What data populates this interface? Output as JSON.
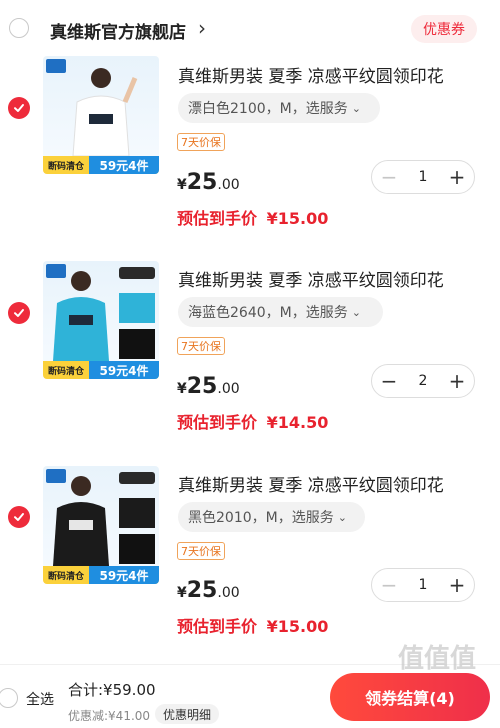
{
  "store": {
    "name": "真维斯官方旗舰店",
    "chevron": "›",
    "coupon_label": "优惠券"
  },
  "items": [
    {
      "title": "真维斯男装 夏季 凉感平纹圆领印花",
      "variant": "漂白色2100，M，选服务",
      "tag": "7天价保",
      "price_symbol": "¥",
      "price_int": "25",
      "price_dec": ".00",
      "estimate_label": "预估到手价",
      "estimate_value": "¥15.00",
      "qty": "1",
      "thumb_banner_left": "断码清仓",
      "thumb_banner_right": "59元4件",
      "shirt_color": "#ffffff"
    },
    {
      "title": "真维斯男装 夏季 凉感平纹圆领印花",
      "variant": "海蓝色2640，M，选服务",
      "tag": "7天价保",
      "price_symbol": "¥",
      "price_int": "25",
      "price_dec": ".00",
      "estimate_label": "预估到手价",
      "estimate_value": "¥14.50",
      "qty": "2",
      "thumb_banner_left": "断码清仓",
      "thumb_banner_right": "59元4件",
      "shirt_color": "#2fb3d8"
    },
    {
      "title": "真维斯男装 夏季 凉感平纹圆领印花",
      "variant": "黑色2010，M，选服务",
      "tag": "7天价保",
      "price_symbol": "¥",
      "price_int": "25",
      "price_dec": ".00",
      "estimate_label": "预估到手价",
      "estimate_value": "¥15.00",
      "qty": "1",
      "thumb_banner_left": "断码清仓",
      "thumb_banner_right": "59元4件",
      "shirt_color": "#1b1b1b"
    }
  ],
  "stepper": {
    "minus": "−",
    "plus": "+"
  },
  "footer": {
    "select_all": "全选",
    "total": "合计:¥59.00",
    "discount": "优惠减:¥41.00",
    "discount_detail": "优惠明细",
    "checkout": "领券结算(4)"
  },
  "watermark": "值值值"
}
